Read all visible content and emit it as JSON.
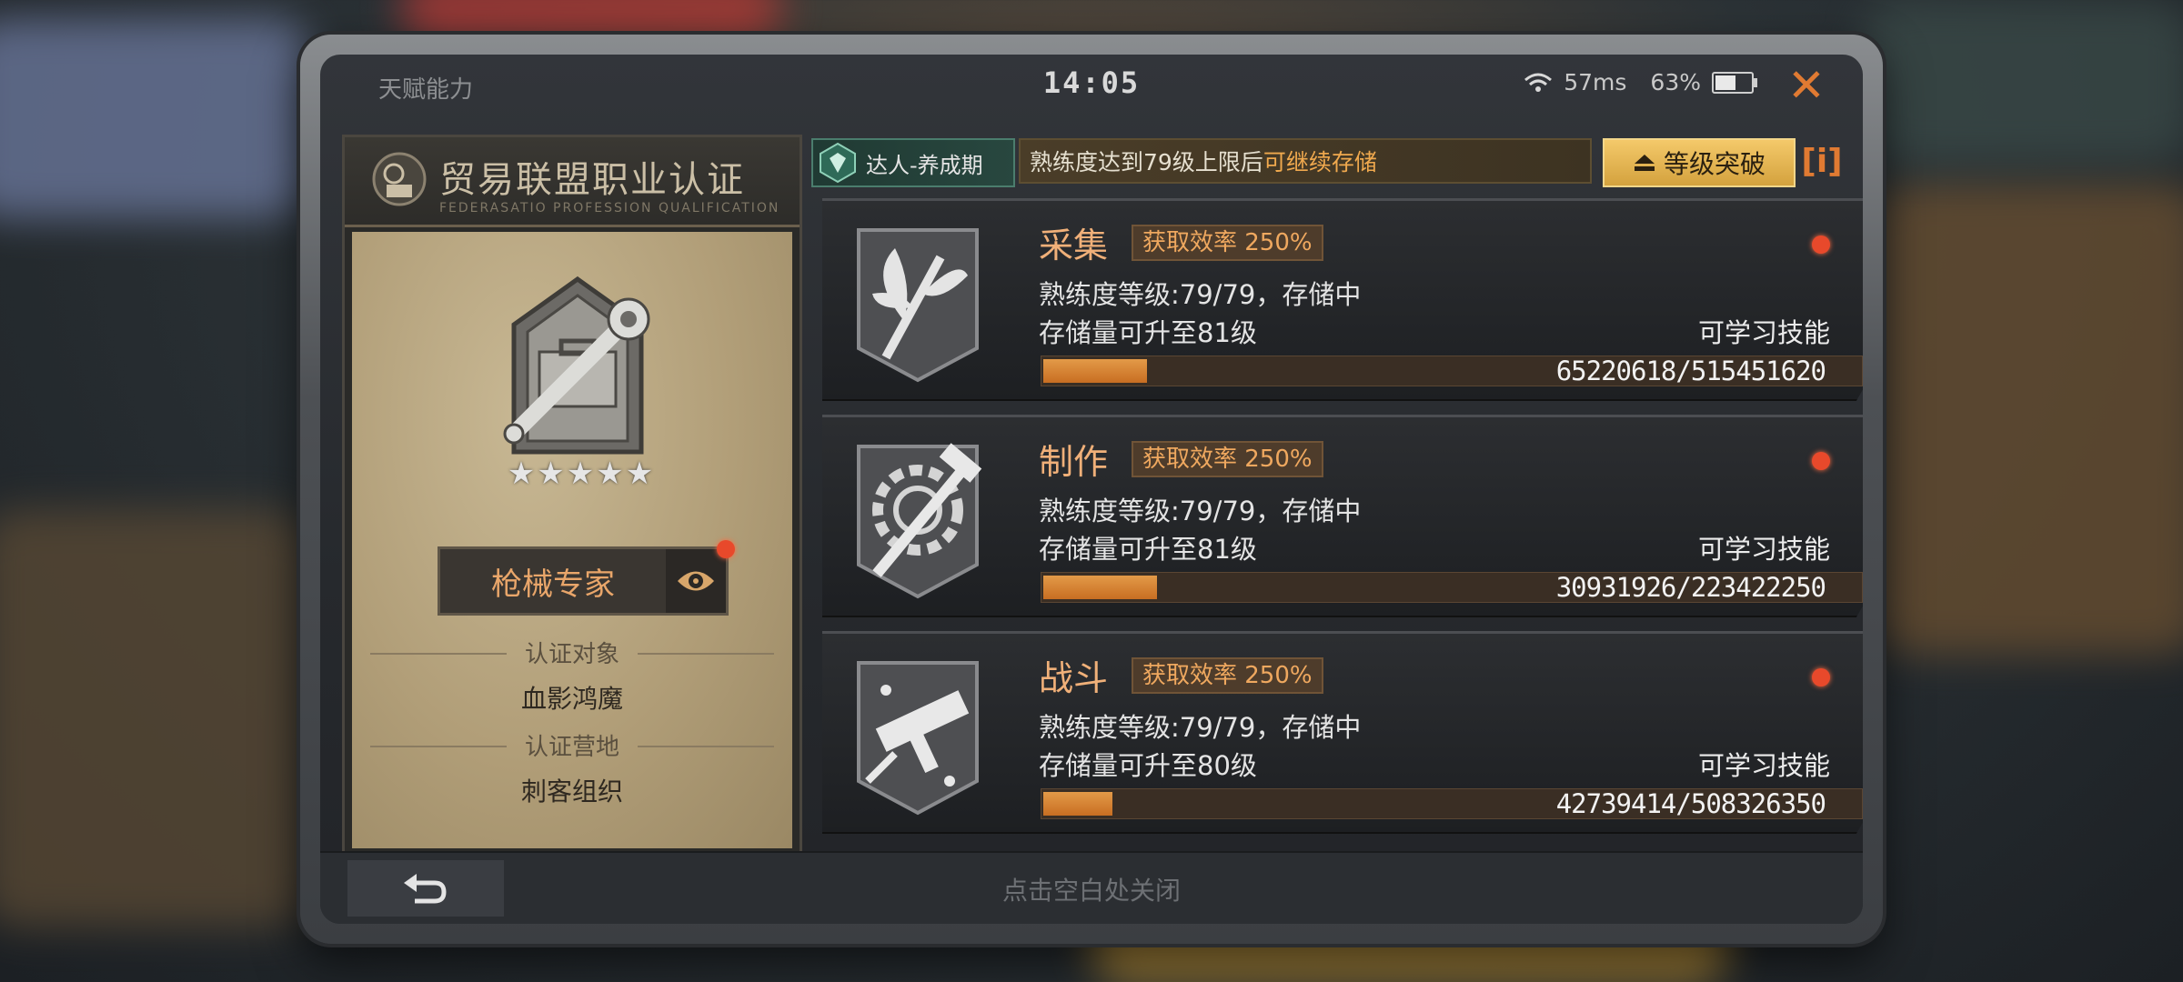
{
  "status_bar": {
    "title": "天赋能力",
    "time": "14:05",
    "ping": "57ms",
    "battery": "63%",
    "battery_level": 0.63
  },
  "certificate": {
    "title": "贸易联盟职业认证",
    "subtitle": "FEDERASATIO PROFESSION QUALIFICATION",
    "job_label": "枪械专家",
    "stars": 5,
    "target_label": "认证对象",
    "target_value": "血影鸿魔",
    "camp_label": "认证营地",
    "camp_value": "刺客组织"
  },
  "banner": {
    "rank_label": "达人-养成期",
    "message_prefix": "熟练度达到79级上限后",
    "message_highlight": "可继续存储",
    "breakthrough_label": "等级突破",
    "info_label": "i"
  },
  "skills": [
    {
      "name": "采集",
      "efficiency": "获取效率 250%",
      "proficiency": "熟练度等级:79/79，存储中",
      "storage": "存储量可升至81级",
      "learn": "可学习技能",
      "progress_text": "65220618/515451620",
      "progress": 0.1265
    },
    {
      "name": "制作",
      "efficiency": "获取效率 250%",
      "proficiency": "熟练度等级:79/79，存储中",
      "storage": "存储量可升至81级",
      "learn": "可学习技能",
      "progress_text": "30931926/223422250",
      "progress": 0.1384
    },
    {
      "name": "战斗",
      "efficiency": "获取效率 250%",
      "proficiency": "熟练度等级:79/79，存储中",
      "storage": "存储量可升至80级",
      "learn": "可学习技能",
      "progress_text": "42739414/508326350",
      "progress": 0.0841
    }
  ],
  "bottom": {
    "hint": "点击空白处关闭"
  },
  "colors": {
    "accent_orange": "#e07a32",
    "gold": "#f0a94e",
    "notify_red": "#e8492b"
  },
  "icons": [
    "wifi-icon",
    "battery-icon",
    "close-icon",
    "eye-icon",
    "back-arrow-icon",
    "leaf-icon",
    "gear-hammer-icon",
    "smg-icon",
    "wrench-toolbox-icon",
    "rank-gem-icon",
    "level-up-icon"
  ]
}
